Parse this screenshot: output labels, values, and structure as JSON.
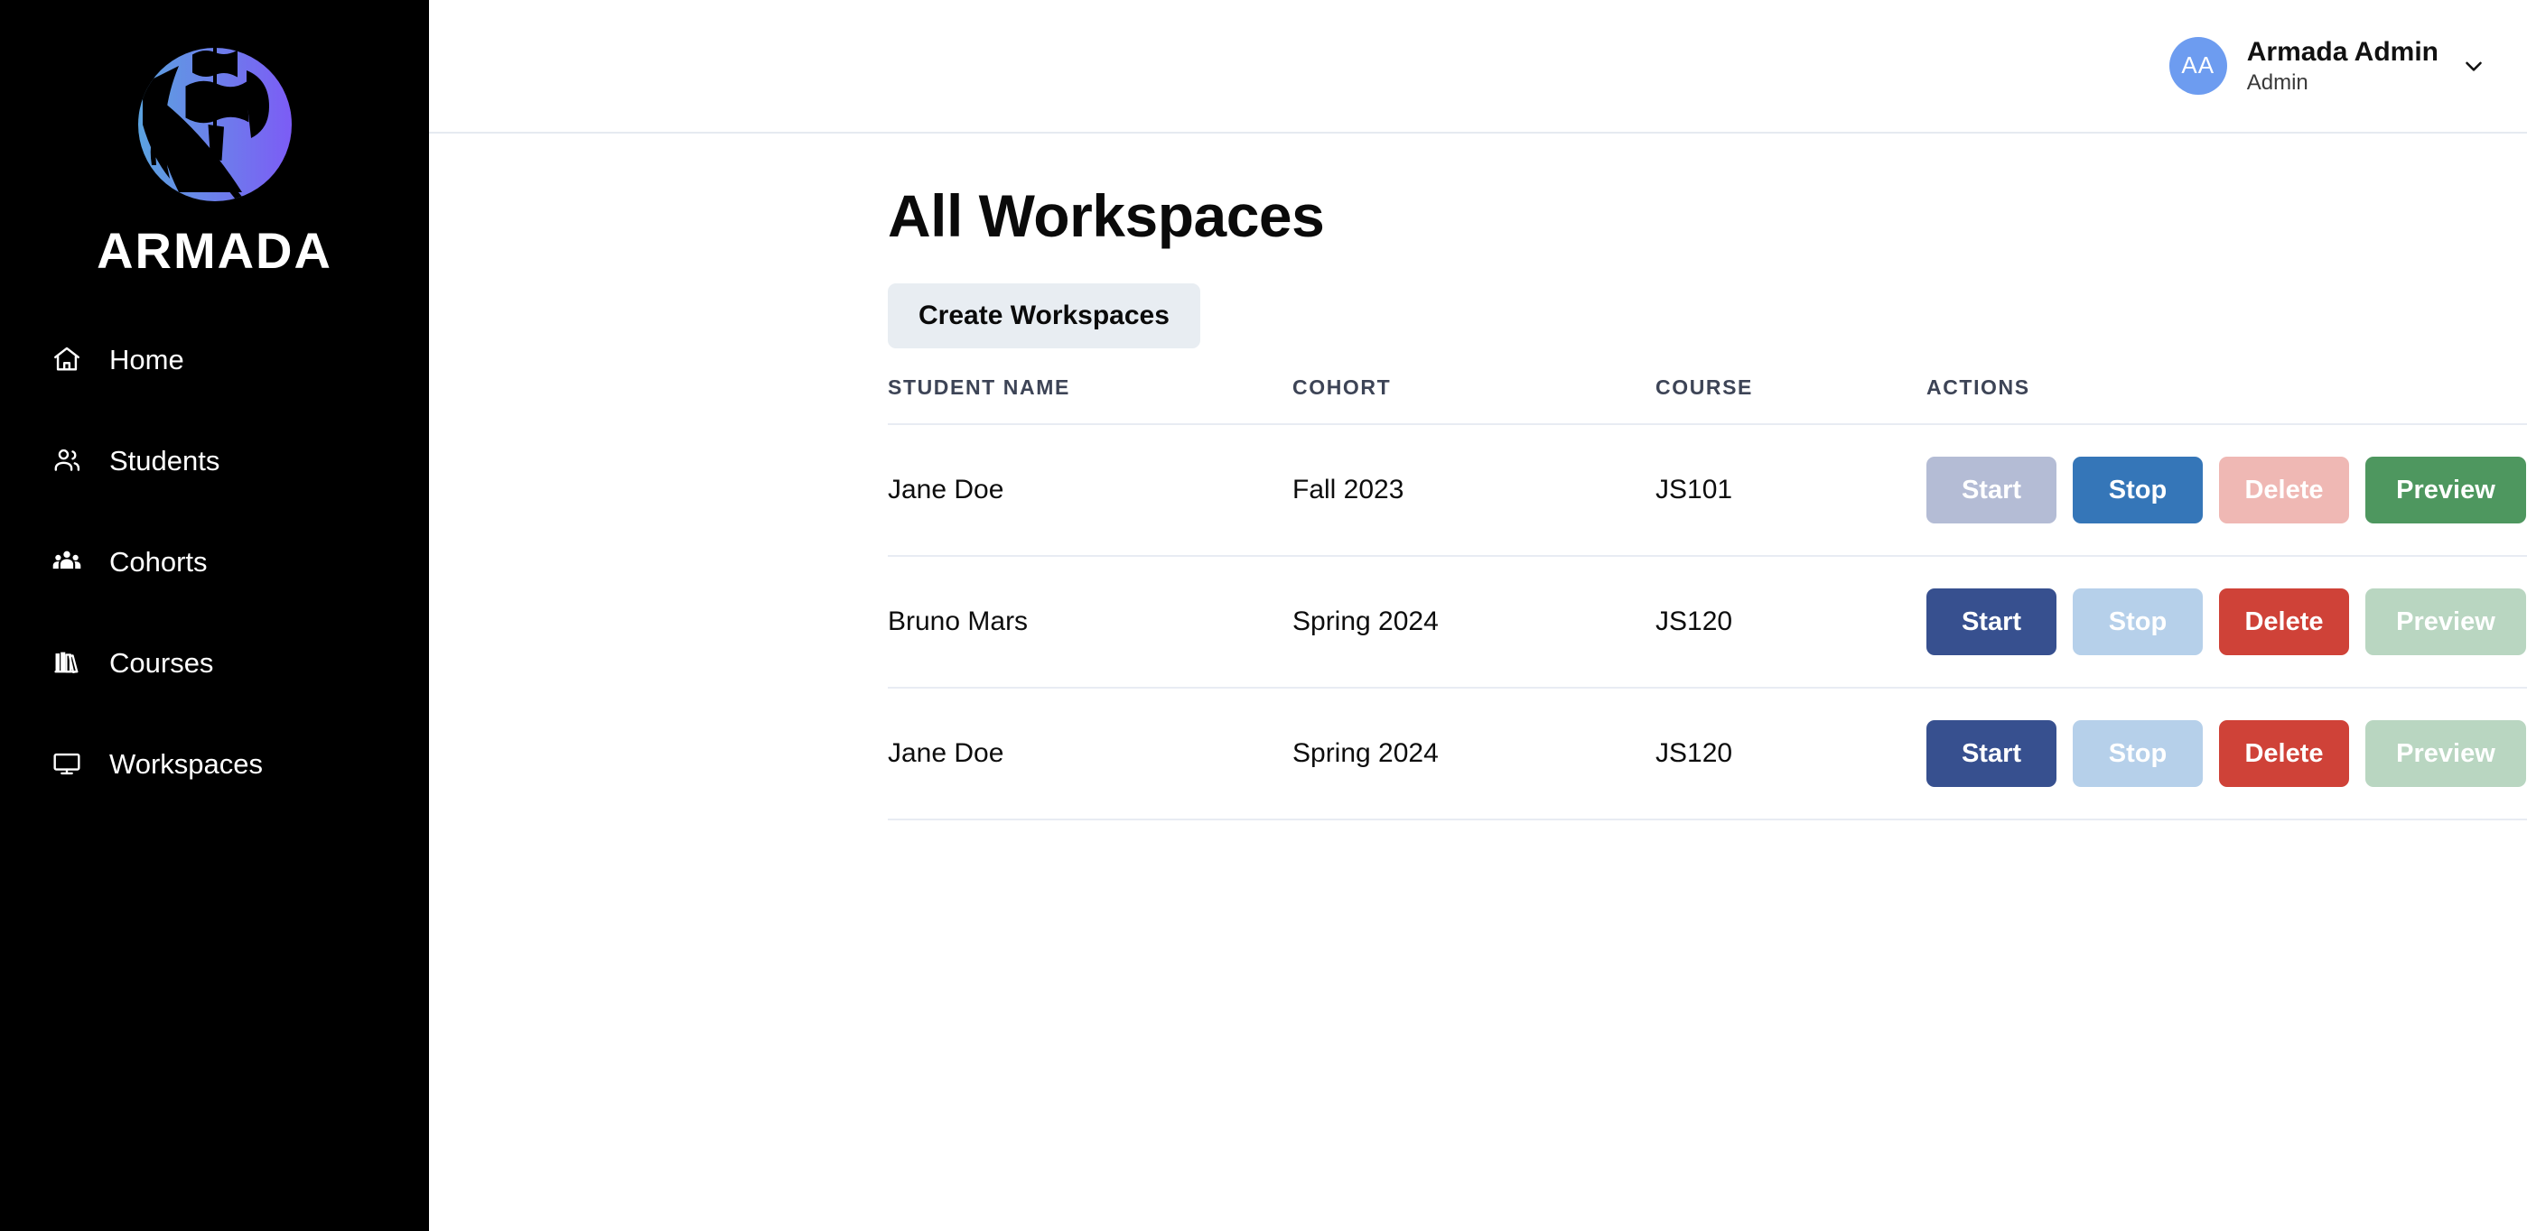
{
  "sidebar": {
    "brand": {
      "name": "ARMADA",
      "logo_icon": "armada-ship-logo",
      "gradient_from": "#5ba3e0",
      "gradient_to": "#7c5cf5"
    },
    "items": [
      {
        "label": "Home",
        "icon": "home-icon"
      },
      {
        "label": "Students",
        "icon": "users-icon"
      },
      {
        "label": "Cohorts",
        "icon": "group-icon"
      },
      {
        "label": "Courses",
        "icon": "books-icon"
      },
      {
        "label": "Workspaces",
        "icon": "monitor-icon"
      }
    ]
  },
  "topbar": {
    "avatar_initials": "AA",
    "avatar_color": "#6d9cf0",
    "user_name": "Armada Admin",
    "user_role": "Admin",
    "chevron_icon": "chevron-down-icon"
  },
  "main": {
    "page_title": "All Workspaces",
    "create_button": "Create Workspaces"
  },
  "table": {
    "columns": [
      "STUDENT NAME",
      "COHORT",
      "COURSE",
      "ACTIONS"
    ],
    "action_labels": {
      "start": "Start",
      "stop": "Stop",
      "delete": "Delete",
      "preview": "Preview"
    },
    "rows": [
      {
        "student_name": "Jane Doe",
        "cohort": "Fall 2023",
        "course": "JS101",
        "actions": {
          "start": "disabled",
          "stop": "enabled",
          "delete": "disabled",
          "preview": "enabled"
        }
      },
      {
        "student_name": "Bruno Mars",
        "cohort": "Spring 2024",
        "course": "JS120",
        "actions": {
          "start": "enabled",
          "stop": "disabled",
          "delete": "enabled",
          "preview": "disabled"
        }
      },
      {
        "student_name": "Jane Doe",
        "cohort": "Spring 2024",
        "course": "JS120",
        "actions": {
          "start": "enabled",
          "stop": "disabled",
          "delete": "enabled",
          "preview": "disabled"
        }
      }
    ]
  },
  "colors": {
    "sidebar_bg": "#000000",
    "start_enabled": "#37508f",
    "start_disabled": "#b4bcd5",
    "stop_enabled": "#3576b8",
    "stop_disabled": "#b6d0ea",
    "delete_enabled": "#cf4238",
    "delete_disabled": "#efb8b4",
    "preview_enabled": "#4e975f",
    "preview_disabled": "#b9d6c1",
    "create_button_bg": "#e8edf2",
    "divider": "#e8ecf3",
    "header_text": "#3d4456"
  }
}
